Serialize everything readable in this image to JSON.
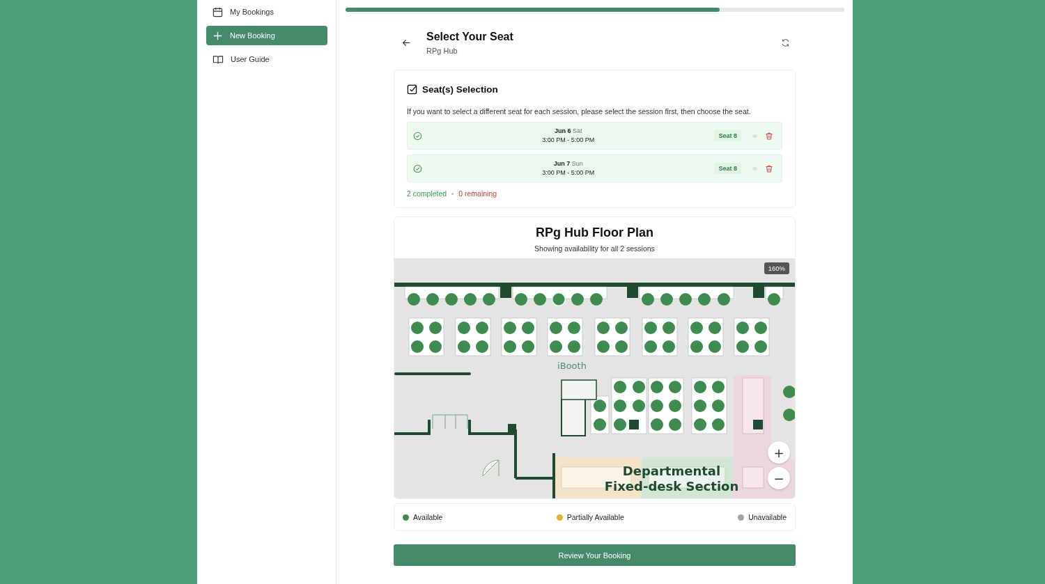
{
  "sidebar": {
    "items": [
      {
        "kind": "calendar",
        "label": "My Bookings",
        "selected": false
      },
      {
        "kind": "plus",
        "label": "New Booking",
        "selected": true
      },
      {
        "kind": "book",
        "label": "User Guide",
        "selected": false
      }
    ]
  },
  "progress": {
    "level": 0.75
  },
  "header": {
    "title": "Select Your Seat",
    "subtitle": "RPg Hub"
  },
  "selection": {
    "title": "Seat(s) Selection",
    "instructions": "If you want to select a different seat for each session, please select the session first, then choose the seat.",
    "sessions": [
      {
        "date": "Jun 6",
        "weekday": "Sat",
        "time": "3:00 PM - 5:00 PM",
        "seat": "Seat 8",
        "completed": true
      },
      {
        "date": "Jun 7",
        "weekday": "Sun",
        "time": "3:00 PM - 5:00 PM",
        "seat": "Seat 8",
        "completed": true
      }
    ],
    "completed": "2 completed",
    "remaining": "0 remaining"
  },
  "floor_plan": {
    "title": "RPg Hub Floor Plan",
    "subtitle": "Showing availability for all 2 sessions",
    "zoom": "160%",
    "zoom_in": "+",
    "zoom_out": "−",
    "labels": [
      {
        "kind": "booth",
        "text": "iBooth"
      },
      {
        "kind": "section",
        "text": "Departmental"
      },
      {
        "kind": "section",
        "text": "Fixed-desk Section"
      }
    ],
    "seats": [
      {
        "selected": false
      },
      {
        "selected": false
      },
      {
        "selected": false
      },
      {
        "selected": false
      },
      {
        "selected": false
      },
      {
        "selected": false
      },
      {
        "selected": false
      },
      {
        "selected": true
      },
      {
        "selected": false
      },
      {
        "selected": false
      },
      {
        "selected": false
      },
      {
        "selected": false
      },
      {
        "selected": false
      },
      {
        "selected": false
      },
      {
        "selected": false
      },
      {
        "selected": false
      },
      {
        "selected": false
      },
      {
        "selected": false
      },
      {
        "selected": false
      },
      {
        "selected": false
      },
      {
        "selected": false
      },
      {
        "selected": false
      },
      {
        "selected": false
      },
      {
        "selected": false
      },
      {
        "selected": false
      },
      {
        "selected": false
      },
      {
        "selected": false
      },
      {
        "selected": false
      },
      {
        "selected": false
      },
      {
        "selected": false
      },
      {
        "selected": false
      },
      {
        "selected": false
      },
      {
        "selected": false
      },
      {
        "selected": false
      },
      {
        "selected": false
      },
      {
        "selected": false
      },
      {
        "selected": false
      },
      {
        "selected": false
      },
      {
        "selected": false
      },
      {
        "selected": false
      },
      {
        "selected": false
      },
      {
        "selected": false
      },
      {
        "selected": false
      },
      {
        "selected": false
      },
      {
        "selected": false
      },
      {
        "selected": false
      },
      {
        "selected": false
      },
      {
        "selected": false
      },
      {
        "selected": false
      },
      {
        "selected": false
      },
      {
        "selected": false
      },
      {
        "selected": false
      },
      {
        "selected": false
      },
      {
        "selected": false
      },
      {
        "selected": false
      },
      {
        "selected": false
      },
      {
        "selected": false
      },
      {
        "selected": false
      },
      {
        "selected": false
      },
      {
        "selected": false
      },
      {
        "selected": false
      },
      {
        "selected": false
      },
      {
        "selected": false
      },
      {
        "selected": false
      },
      {
        "selected": false
      },
      {
        "selected": false
      },
      {
        "selected": false
      },
      {
        "selected": false
      },
      {
        "selected": false
      }
    ]
  },
  "legend": [
    {
      "label": "Available",
      "color": "#3d8b4f"
    },
    {
      "label": "Partially Available",
      "color": "#e0b13c"
    },
    {
      "label": "Unavailable",
      "color": "#a3a3a8"
    }
  ],
  "review_button": "Review Your Booking"
}
